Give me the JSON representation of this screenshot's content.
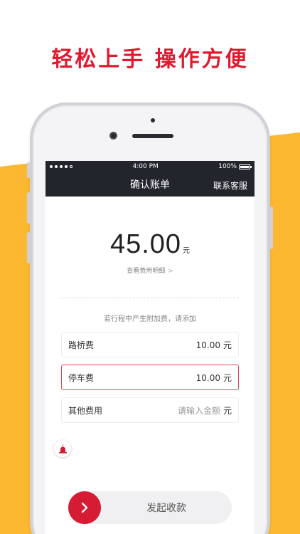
{
  "promo": {
    "title": "轻松上手  操作方便"
  },
  "colors": {
    "accent_red": "#e0192f",
    "yellow": "#fcb831",
    "navbar": "#22252c"
  },
  "status_bar": {
    "time": "4:00 PM",
    "battery": "100%"
  },
  "nav": {
    "title": "确认账单",
    "right_action": "联系客服"
  },
  "bill": {
    "amount": "45.00",
    "unit": "元",
    "detail_link": "查看费用明细"
  },
  "fees": {
    "hint": "若行程中产生附加费，请添加",
    "items": [
      {
        "label": "路桥费",
        "value": "10.00",
        "unit": "元"
      },
      {
        "label": "停车费",
        "value": "10.00",
        "unit": "元"
      },
      {
        "label": "其他费用",
        "placeholder": "请输入金额",
        "unit": "元"
      }
    ]
  },
  "actions": {
    "collect_label": "发起收款"
  },
  "icons": {
    "alarm": "alarm-icon",
    "chevron": "chevron-right-icon",
    "arrow": "arrow-right-icon"
  }
}
